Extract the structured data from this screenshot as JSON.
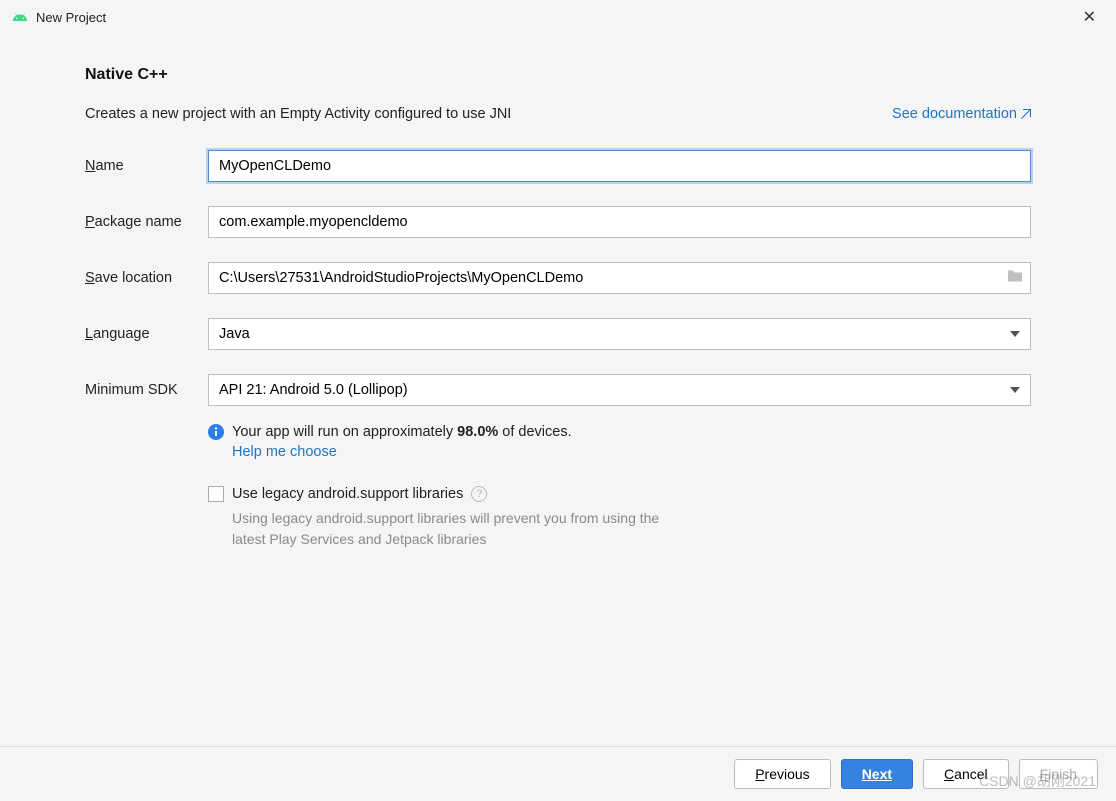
{
  "window": {
    "title": "New Project"
  },
  "header": {
    "heading": "Native C++",
    "subtext": "Creates a new project with an Empty Activity configured to use JNI",
    "doc_link": "See documentation"
  },
  "form": {
    "name_label": "ame",
    "name_value": "MyOpenCLDemo",
    "package_label": "ackage name",
    "package_value": "com.example.myopencldemo",
    "save_label": "ave location",
    "save_value": "C:\\Users\\27531\\AndroidStudioProjects\\MyOpenCLDemo",
    "language_label": "anguage",
    "language_value": "Java",
    "sdk_label": "Minimum SDK",
    "sdk_value": "API 21: Android 5.0 (Lollipop)"
  },
  "info": {
    "text_pre": "Your app will run on approximately ",
    "percent": "98.0%",
    "text_post": " of devices.",
    "help_link": "Help me choose"
  },
  "legacy": {
    "label": "Use legacy android.support libraries",
    "desc": "Using legacy android.support libraries will prevent you from using the latest Play Services and Jetpack libraries"
  },
  "footer": {
    "previous": "revious",
    "next": "Next",
    "cancel": "ancel",
    "finish": "inish"
  },
  "watermark": "CSDN @胡刚2021"
}
